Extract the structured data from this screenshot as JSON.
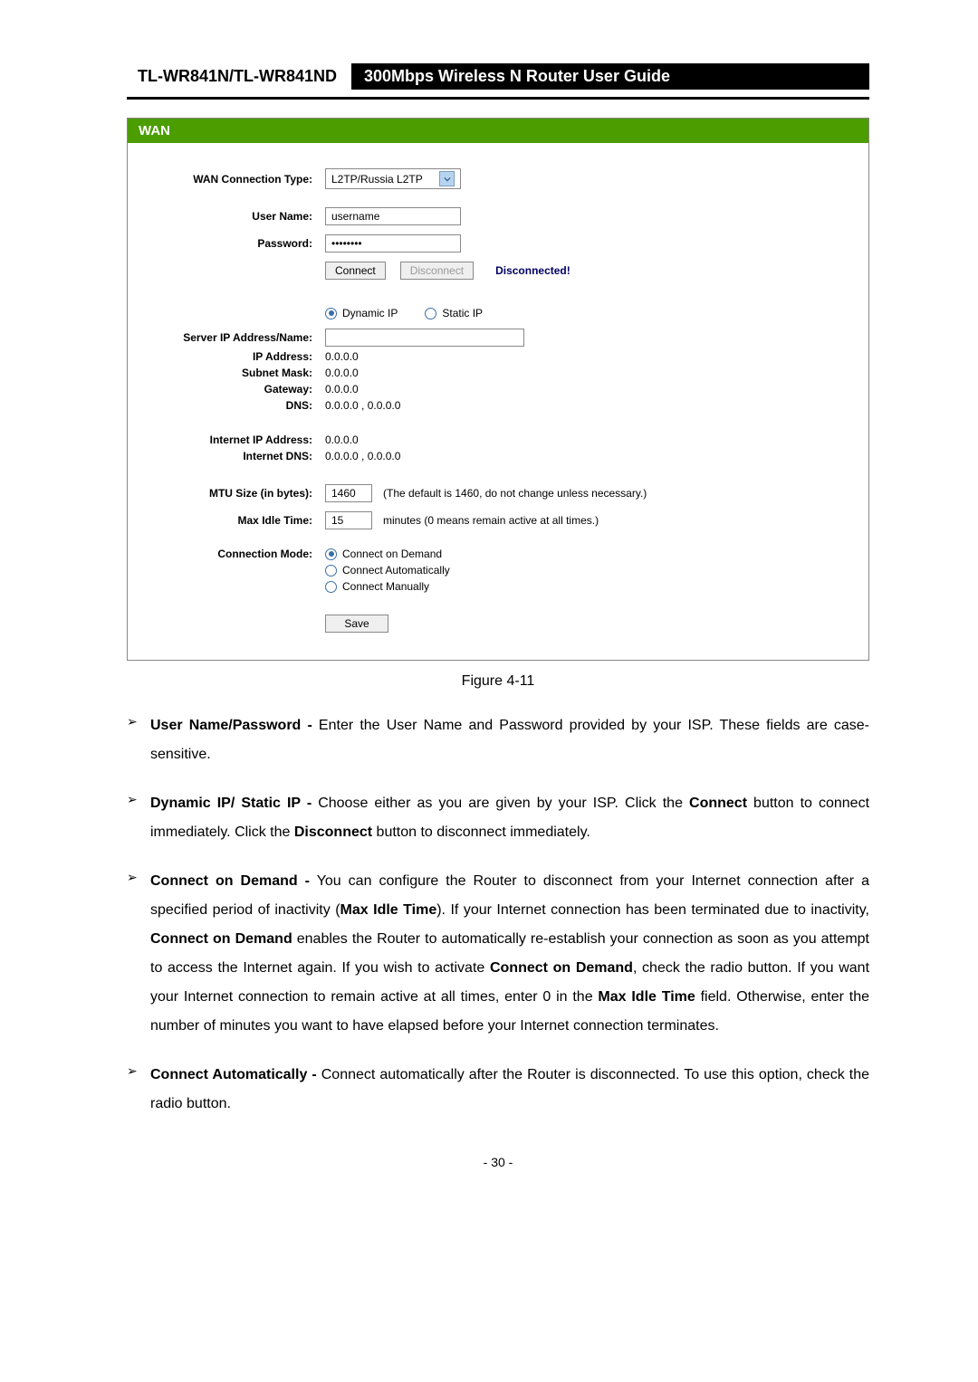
{
  "header": {
    "model": "TL-WR841N/TL-WR841ND",
    "title": "300Mbps Wireless N Router User Guide"
  },
  "wan": {
    "panel_title": "WAN",
    "labels": {
      "conn_type": "WAN Connection Type:",
      "username": "User Name:",
      "password": "Password:",
      "server_ip": "Server IP Address/Name:",
      "ip_address": "IP Address:",
      "subnet": "Subnet Mask:",
      "gateway": "Gateway:",
      "dns": "DNS:",
      "internet_ip": "Internet IP Address:",
      "internet_dns": "Internet DNS:",
      "mtu": "MTU Size (in bytes):",
      "max_idle": "Max Idle Time:",
      "conn_mode": "Connection Mode:"
    },
    "values": {
      "conn_type": "L2TP/Russia L2TP",
      "username": "username",
      "password": "••••••••",
      "connect_btn": "Connect",
      "disconnect_btn": "Disconnect",
      "status": "Disconnected!",
      "dynamic_ip": "Dynamic IP",
      "static_ip": "Static IP",
      "server_ip": "",
      "ip_address": "0.0.0.0",
      "subnet": "0.0.0.0",
      "gateway": "0.0.0.0",
      "dns": "0.0.0.0 , 0.0.0.0",
      "internet_ip": "0.0.0.0",
      "internet_dns": "0.0.0.0 , 0.0.0.0",
      "mtu": "1460",
      "mtu_note": "(The default is 1460, do not change unless necessary.)",
      "max_idle": "15",
      "max_idle_note": "minutes (0 means remain active at all times.)",
      "mode_demand": "Connect on Demand",
      "mode_auto": "Connect Automatically",
      "mode_manual": "Connect Manually",
      "save_btn": "Save"
    }
  },
  "figure_caption": "Figure 4-11",
  "bullets": {
    "b1_title": "User Name/Password -",
    "b1_text": " Enter the User Name and Password provided by your ISP. These fields are case-sensitive.",
    "b2_title": "Dynamic IP/ Static IP -",
    "b2_text_a": " Choose either as you are given by your ISP. Click the ",
    "b2_bold_a": "Connect",
    "b2_text_b": " button to connect immediately. Click the ",
    "b2_bold_b": "Disconnect",
    "b2_text_c": " button to disconnect immediately.",
    "b3_title": "Connect on Demand -",
    "b3_text_a": " You can configure the Router to disconnect from your Internet connection after a specified period of inactivity (",
    "b3_bold_a": "Max Idle Time",
    "b3_text_b": "). If your Internet connection has been terminated due to inactivity, ",
    "b3_bold_b": "Connect on Demand",
    "b3_text_c": " enables the Router to automatically re-establish your connection as soon as you attempt to access the Internet again. If you wish to activate ",
    "b3_bold_c": "Connect on Demand",
    "b3_text_d": ", check the radio button. If you want your Internet connection to remain active at all times, enter 0 in the ",
    "b3_bold_d": "Max Idle Time",
    "b3_text_e": " field. Otherwise, enter the number of minutes you want to have elapsed before your Internet connection terminates.",
    "b4_title": "Connect Automatically -",
    "b4_text": " Connect automatically after the Router is disconnected. To use this option, check the radio button."
  },
  "page_number": "- 30 -"
}
